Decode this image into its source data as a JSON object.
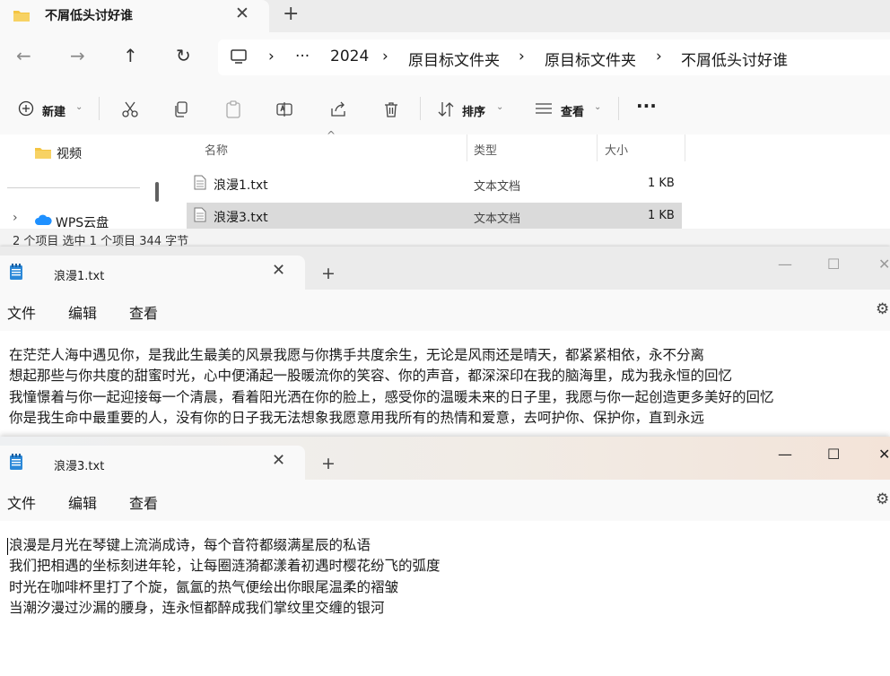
{
  "explorer": {
    "tab_title": "不屑低头讨好谁",
    "tab_close": "✕",
    "new_tab": "+",
    "breadcrumb": {
      "more": "···",
      "items": [
        "2024",
        "原目标文件夹",
        "原目标文件夹",
        "不屑低头讨好谁"
      ],
      "separator": "›"
    },
    "toolbar": {
      "new_label": "新建",
      "sort_label": "排序",
      "view_label": "查看",
      "more_label": "···"
    },
    "nav": {
      "videos": "视频",
      "wps": "WPS云盘"
    },
    "columns": {
      "name": "名称",
      "type": "类型",
      "size": "大小"
    },
    "files": [
      {
        "name": "浪漫1.txt",
        "type": "文本文档",
        "size": "1 KB",
        "selected": false
      },
      {
        "name": "浪漫3.txt",
        "type": "文本文档",
        "size": "1 KB",
        "selected": true
      }
    ],
    "status": "2 个项目    选中 1 个项目  344 字节"
  },
  "notepad1": {
    "tab_title": "浪漫1.txt",
    "tab_close": "✕",
    "new_tab": "+",
    "menu": {
      "file": "文件",
      "edit": "编辑",
      "view": "查看"
    },
    "lines": [
      "在茫茫人海中遇见你，是我此生最美的风景我愿与你携手共度余生，无论是风雨还是晴天，都紧紧相依，永不分离",
      "想起那些与你共度的甜蜜时光，心中便涌起一股暖流你的笑容、你的声音，都深深印在我的脑海里，成为我永恒的回忆",
      "我憧憬着与你一起迎接每一个清晨，看着阳光洒在你的脸上，感受你的温暖未来的日子里，我愿与你一起创造更多美好的回忆",
      "你是我生命中最重要的人，没有你的日子我无法想象我愿意用我所有的热情和爱意，去呵护你、保护你，直到永远"
    ]
  },
  "notepad2": {
    "tab_title": "浪漫3.txt",
    "tab_close": "✕",
    "new_tab": "+",
    "menu": {
      "file": "文件",
      "edit": "编辑",
      "view": "查看"
    },
    "lines": [
      "浪漫是月光在琴键上流淌成诗，每个音符都缀满星辰的私语",
      "我们把相遇的坐标刻进年轮，让每圈涟漪都漾着初遇时樱花纷飞的弧度",
      "时光在咖啡杯里打了个旋，氤氲的热气便绘出你眼尾温柔的褶皱",
      "当潮汐漫过沙漏的腰身，连永恒都醉成我们掌纹里交缠的银河"
    ]
  },
  "colors": {
    "folder": "#f4c542",
    "notepad_icon": "#2b88d8",
    "selected_row": "#dadada",
    "cloud": "#1e90ff"
  }
}
